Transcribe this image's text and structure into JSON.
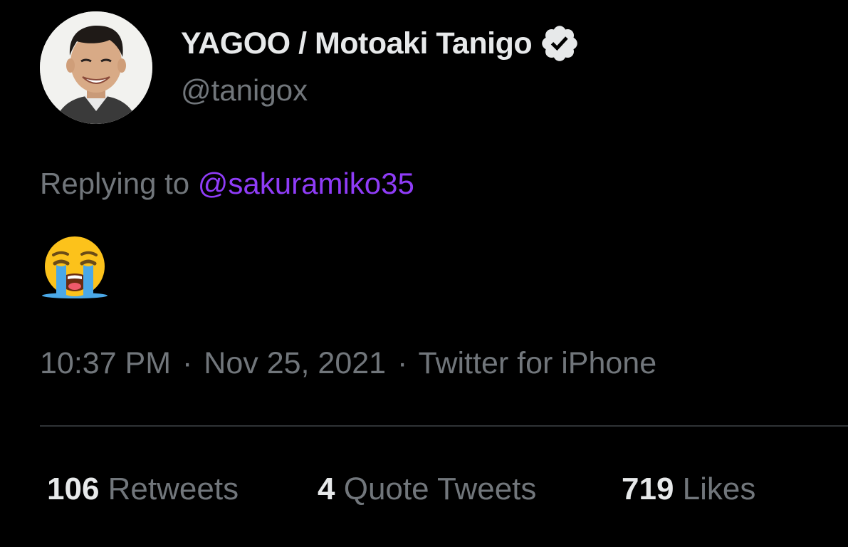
{
  "author": {
    "display_name": "YAGOO / Motoaki Tanigo",
    "handle": "@tanigox",
    "verified": true
  },
  "reply": {
    "prefix": "Replying to",
    "mention": "@sakuramiko35"
  },
  "body": {
    "emoji": "loudly-crying-face"
  },
  "meta": {
    "time": "10:37 PM",
    "separator": "·",
    "date": "Nov 25, 2021",
    "source": "Twitter for iPhone"
  },
  "stats": {
    "retweets_count": "106",
    "retweets_label": "Retweets",
    "quotes_count": "4",
    "quotes_label": "Quote Tweets",
    "likes_count": "719",
    "likes_label": "Likes"
  },
  "colors": {
    "background": "#000000",
    "primary_text": "#e7e9ea",
    "secondary_text": "#71767b",
    "mention": "#8f3cf7",
    "divider": "#2f3336"
  }
}
